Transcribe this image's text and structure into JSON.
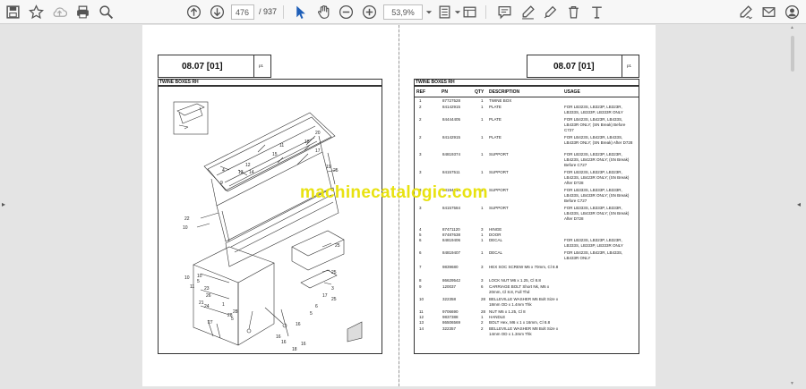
{
  "toolbar": {
    "page_current": "476",
    "page_total": "/ 937",
    "zoom": "53,9%"
  },
  "left_page": {
    "title": "08.07 [01]",
    "page_tag": "p1",
    "section": "TWINE BOXES RH",
    "callouts": [
      "20",
      "18",
      "17",
      "11",
      "15",
      "12",
      "13",
      "4",
      "9",
      "14",
      "19",
      "22",
      "10",
      "10",
      "5",
      "23",
      "26",
      "28",
      "5",
      "24",
      "10",
      "11",
      "21",
      "1",
      "27",
      "25",
      "25",
      "25",
      "3",
      "25",
      "16",
      "16",
      "16",
      "5",
      "6",
      "17",
      "16",
      "18",
      "28"
    ]
  },
  "right_page": {
    "title": "08.07 [01]",
    "page_tag": "p1",
    "section": "TWINE BOXES RH",
    "headers": {
      "ref": "REF",
      "pn": "PN",
      "qty": "QTY",
      "desc": "DESCRIPTION",
      "usage": "USAGE"
    },
    "rows": [
      {
        "ref": "1",
        "pn": "87727528",
        "qty": "1",
        "desc": "TWINE BOX",
        "usage": ""
      },
      {
        "ref": "2",
        "pn": "84142915",
        "qty": "1",
        "desc": "PLATE",
        "usage": "FOR LB323S, LB323P, LB323R, LB333S, LB333P, LB333R ONLY"
      },
      {
        "ref": "2",
        "pn": "84444405",
        "qty": "1",
        "desc": "PLATE",
        "usage": "FOR LB423S, LB423R, LB433S, LB433R ONLY; (SN Break) Before C727"
      },
      {
        "ref": "2",
        "pn": "84142915",
        "qty": "1",
        "desc": "PLATE",
        "usage": "FOR LB423S, LB423R, LB433S, LB433R ONLY; (SN Break) After D728"
      },
      {
        "ref": "3",
        "pn": "84819374",
        "qty": "1",
        "desc": "SUPPORT",
        "usage": "FOR LB323S, LB323P, LB323R, LB423S, LB423R ONLY; (SN Break) Before C727"
      },
      {
        "ref": "3",
        "pn": "84157511",
        "qty": "1",
        "desc": "SUPPORT",
        "usage": "FOR LB323S, LB323P, LB323R, LB423S, LB423R ONLY; (SN Break) After D728"
      },
      {
        "ref": "3",
        "pn": "84194613",
        "qty": "1",
        "desc": "SUPPORT",
        "usage": "FOR LB333S, LB333P, LB333R, LB433S, LB433R ONLY; (SN Break) Before C727"
      },
      {
        "ref": "3",
        "pn": "84157584",
        "qty": "1",
        "desc": "SUPPORT",
        "usage": "FOR LB333S, LB333P, LB333R, LB433S, LB433R ONLY; (SN Break) After D728"
      },
      {
        "ref": "4",
        "pn": "87471120",
        "qty": "3",
        "desc": "HINGE",
        "usage": ""
      },
      {
        "ref": "5",
        "pn": "87487638",
        "qty": "1",
        "desc": "DOOR",
        "usage": ""
      },
      {
        "ref": "6",
        "pn": "84819406",
        "qty": "1",
        "desc": "DECAL",
        "usage": "FOR LB323S, LB323P, LB323R, LB333S, LB333P, LB333R ONLY"
      },
      {
        "ref": "6",
        "pn": "84819407",
        "qty": "1",
        "desc": "DECAL",
        "usage": "FOR LB423S, LB423R, LB433S, LB433R ONLY"
      },
      {
        "ref": "7",
        "pn": "9839680",
        "qty": "3",
        "desc": "HEX SOC SCREW M6 x 70mm, Cl 8.8",
        "usage": ""
      },
      {
        "ref": "8",
        "pn": "86629542",
        "qty": "3",
        "desc": "LOCK NUT M6 x 1.25, Cl 8.8",
        "usage": ""
      },
      {
        "ref": "9",
        "pn": "120037",
        "qty": "6",
        "desc": "CARRIAGE BOLT Short Nk, M6 x 20mm, Cl 8.8, Full Thd",
        "usage": ""
      },
      {
        "ref": "10",
        "pn": "322358",
        "qty": "28",
        "desc": "BELLEVILLE WASHER M6 Bolt Size x 18mm OD x 1.4mm Thk",
        "usage": ""
      },
      {
        "ref": "11",
        "pn": "9706690",
        "qty": "28",
        "desc": "NUT M6 x 1.25, Cl 8",
        "usage": ""
      },
      {
        "ref": "12",
        "pn": "9837388",
        "qty": "1",
        "desc": "HANDLE",
        "usage": ""
      },
      {
        "ref": "13",
        "pn": "86506569",
        "qty": "2",
        "desc": "BOLT Hex, M6 x 1 x 16mm, Cl 8.8",
        "usage": ""
      },
      {
        "ref": "14",
        "pn": "322357",
        "qty": "2",
        "desc": "BELLEVILLE WASHER M8 Bolt Size x 14mm OD x 1.3mm Thk",
        "usage": ""
      }
    ]
  },
  "watermark": "machinecatalogic.com"
}
